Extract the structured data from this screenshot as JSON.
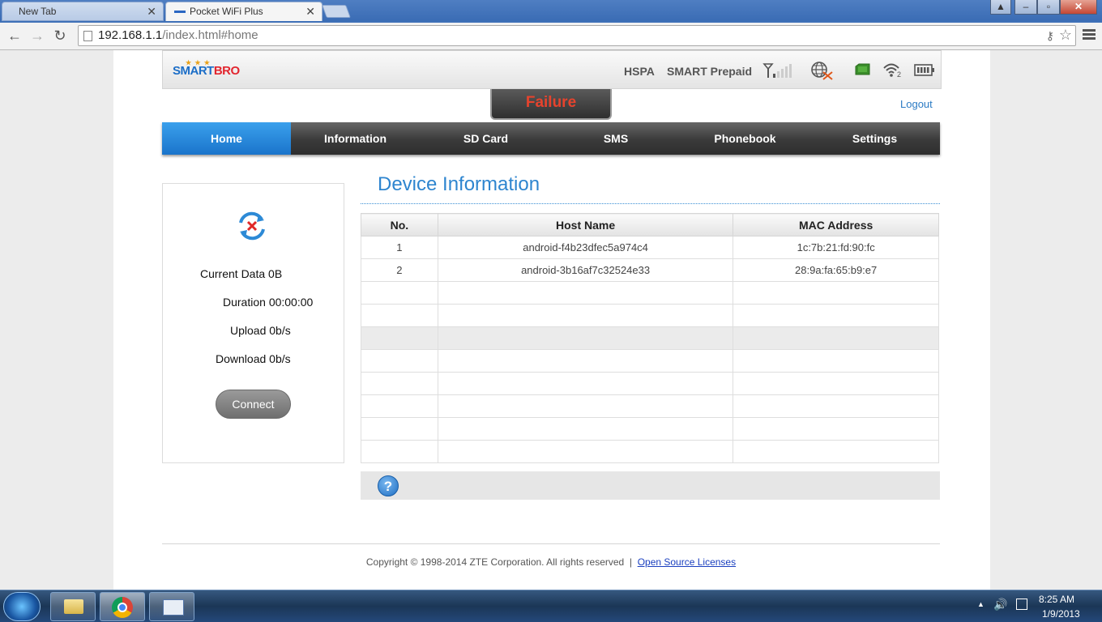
{
  "browser": {
    "tabs": [
      {
        "label": "New Tab"
      },
      {
        "label": "Pocket WiFi Plus"
      }
    ],
    "url_host": "192.168.1.1",
    "url_path": "/index.html#home"
  },
  "header": {
    "logo_part1": "SMART",
    "logo_part2": "BRO",
    "network_type": "HSPA",
    "operator": "SMART Prepaid",
    "connected_clients": "2",
    "status_banner": "Failure",
    "logout_label": "Logout"
  },
  "nav": {
    "items": [
      {
        "label": "Home"
      },
      {
        "label": "Information"
      },
      {
        "label": "SD Card"
      },
      {
        "label": "SMS"
      },
      {
        "label": "Phonebook"
      },
      {
        "label": "Settings"
      }
    ]
  },
  "connection": {
    "current_data_label": "Current Data",
    "current_data_value": "0B",
    "duration_label": "Duration",
    "duration_value": "00:00:00",
    "upload_label": "Upload",
    "upload_value": "0b/s",
    "download_label": "Download",
    "download_value": "0b/s",
    "connect_label": "Connect"
  },
  "device_info": {
    "title": "Device Information",
    "columns": [
      "No.",
      "Host Name",
      "MAC Address"
    ],
    "rows": [
      {
        "no": "1",
        "host": "android-f4b23dfec5a974c4",
        "mac": "1c:7b:21:fd:90:fc"
      },
      {
        "no": "2",
        "host": "android-3b16af7c32524e33",
        "mac": "28:9a:fa:65:b9:e7"
      }
    ],
    "help_label": "?"
  },
  "footer": {
    "copyright": "Copyright © 1998-2014 ZTE Corporation. All rights reserved",
    "separator": "|",
    "link": "Open Source Licenses"
  },
  "taskbar": {
    "time": "8:25 AM",
    "date": "1/9/2013"
  },
  "colors": {
    "accent_blue": "#2e85cf",
    "nav_active": "#1a74cb",
    "failure_red": "#e6432d"
  }
}
